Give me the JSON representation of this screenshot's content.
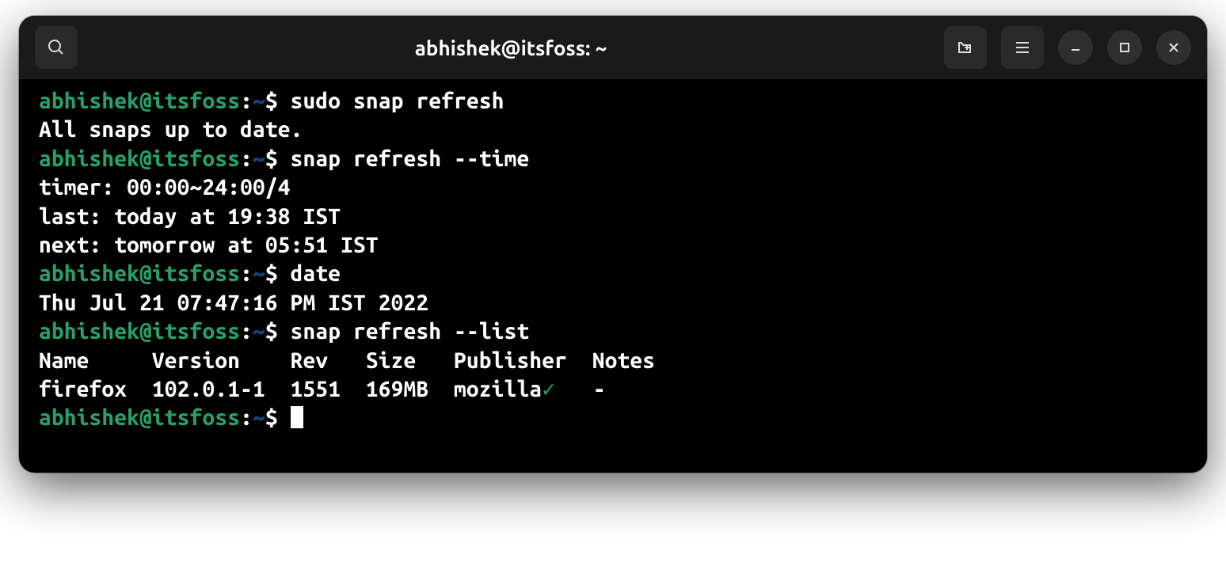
{
  "window": {
    "title": "abhishek@itsfoss: ~"
  },
  "prompt": {
    "user_host": "abhishek@itsfoss",
    "colon": ":",
    "path": "~",
    "symbol": "$"
  },
  "commands": {
    "cmd1": "sudo snap refresh",
    "out1": "All snaps up to date.",
    "cmd2": "snap refresh --time",
    "out2a": "timer: 00:00~24:00/4",
    "out2b": "last: today at 19:38 IST",
    "out2c": "next: tomorrow at 05:51 IST",
    "cmd3": "date",
    "out3": "Thu Jul 21 07:47:16 PM IST 2022",
    "cmd4": "snap refresh --list",
    "out4_header": "Name     Version    Rev   Size   Publisher  Notes",
    "out4_row_a": "firefox  102.0.1-1  1551  169MB  mozilla",
    "out4_check": "✓",
    "out4_row_b": "   -"
  }
}
